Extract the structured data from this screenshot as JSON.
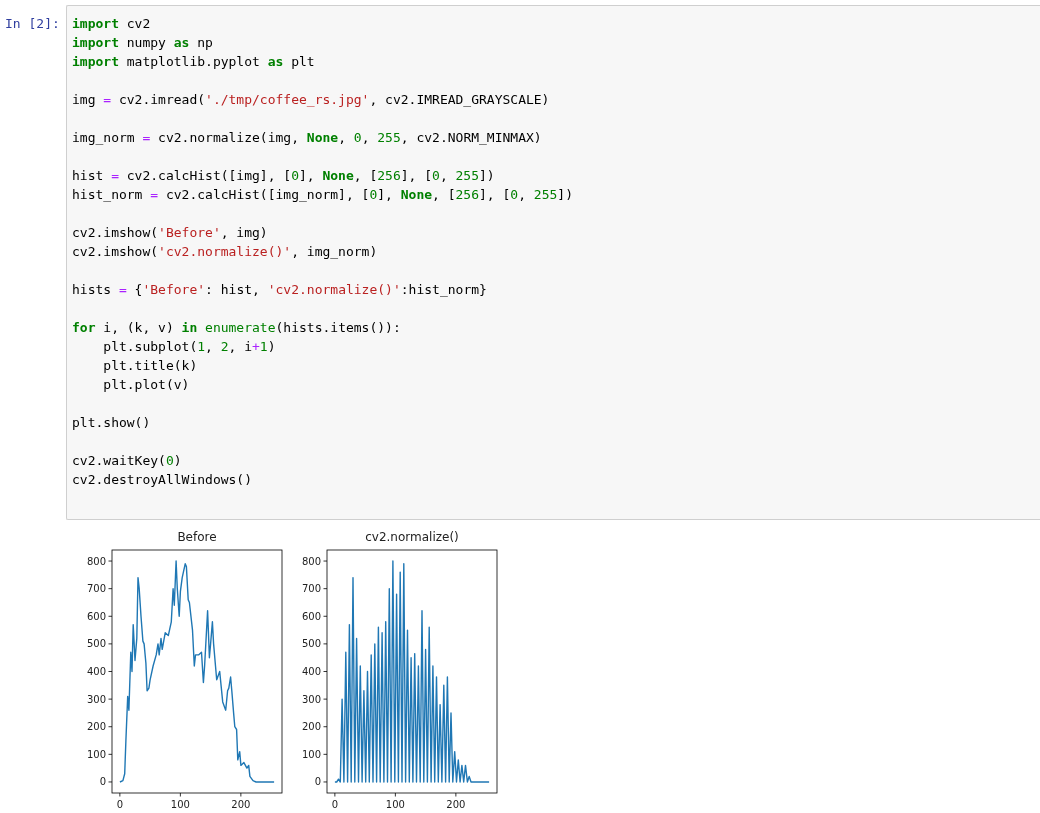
{
  "cell": {
    "prompt": "In [2]:",
    "blocks": [
      [
        [
          {
            "t": "import",
            "kind": "keyword"
          },
          {
            "t": " cv2",
            "kind": "plain"
          }
        ],
        [
          {
            "t": "import",
            "kind": "keyword"
          },
          {
            "t": " numpy ",
            "kind": "plain"
          },
          {
            "t": "as",
            "kind": "keyword"
          },
          {
            "t": " np",
            "kind": "plain"
          }
        ],
        [
          {
            "t": "import",
            "kind": "keyword"
          },
          {
            "t": " matplotlib.pyplot ",
            "kind": "plain"
          },
          {
            "t": "as",
            "kind": "keyword"
          },
          {
            "t": " plt",
            "kind": "plain"
          }
        ]
      ],
      [
        [
          {
            "t": "img ",
            "kind": "plain"
          },
          {
            "t": "=",
            "kind": "operator"
          },
          {
            "t": " cv2.imread(",
            "kind": "plain"
          },
          {
            "t": "'./tmp/coffee_rs.jpg'",
            "kind": "string"
          },
          {
            "t": ", cv2.IMREAD_GRAYSCALE)",
            "kind": "plain"
          }
        ]
      ],
      [
        [
          {
            "t": "img_norm ",
            "kind": "plain"
          },
          {
            "t": "=",
            "kind": "operator"
          },
          {
            "t": " cv2.normalize(img, ",
            "kind": "plain"
          },
          {
            "t": "None",
            "kind": "keyword"
          },
          {
            "t": ", ",
            "kind": "plain"
          },
          {
            "t": "0",
            "kind": "number"
          },
          {
            "t": ", ",
            "kind": "plain"
          },
          {
            "t": "255",
            "kind": "number"
          },
          {
            "t": ", cv2.NORM_MINMAX)",
            "kind": "plain"
          }
        ]
      ],
      [
        [
          {
            "t": "hist ",
            "kind": "plain"
          },
          {
            "t": "=",
            "kind": "operator"
          },
          {
            "t": " cv2.calcHist([img], [",
            "kind": "plain"
          },
          {
            "t": "0",
            "kind": "number"
          },
          {
            "t": "], ",
            "kind": "plain"
          },
          {
            "t": "None",
            "kind": "keyword"
          },
          {
            "t": ", [",
            "kind": "plain"
          },
          {
            "t": "256",
            "kind": "number"
          },
          {
            "t": "], [",
            "kind": "plain"
          },
          {
            "t": "0",
            "kind": "number"
          },
          {
            "t": ", ",
            "kind": "plain"
          },
          {
            "t": "255",
            "kind": "number"
          },
          {
            "t": "])",
            "kind": "plain"
          }
        ],
        [
          {
            "t": "hist_norm ",
            "kind": "plain"
          },
          {
            "t": "=",
            "kind": "operator"
          },
          {
            "t": " cv2.calcHist([img_norm], [",
            "kind": "plain"
          },
          {
            "t": "0",
            "kind": "number"
          },
          {
            "t": "], ",
            "kind": "plain"
          },
          {
            "t": "None",
            "kind": "keyword"
          },
          {
            "t": ", [",
            "kind": "plain"
          },
          {
            "t": "256",
            "kind": "number"
          },
          {
            "t": "], [",
            "kind": "plain"
          },
          {
            "t": "0",
            "kind": "number"
          },
          {
            "t": ", ",
            "kind": "plain"
          },
          {
            "t": "255",
            "kind": "number"
          },
          {
            "t": "])",
            "kind": "plain"
          }
        ]
      ],
      [
        [
          {
            "t": "cv2.imshow(",
            "kind": "plain"
          },
          {
            "t": "'Before'",
            "kind": "string"
          },
          {
            "t": ", img)",
            "kind": "plain"
          }
        ],
        [
          {
            "t": "cv2.imshow(",
            "kind": "plain"
          },
          {
            "t": "'cv2.normalize()'",
            "kind": "string"
          },
          {
            "t": ", img_norm)",
            "kind": "plain"
          }
        ]
      ],
      [
        [
          {
            "t": "hists ",
            "kind": "plain"
          },
          {
            "t": "=",
            "kind": "operator"
          },
          {
            "t": " {",
            "kind": "plain"
          },
          {
            "t": "'Before'",
            "kind": "string"
          },
          {
            "t": ": hist, ",
            "kind": "plain"
          },
          {
            "t": "'cv2.normalize()'",
            "kind": "string"
          },
          {
            "t": ":hist_norm}",
            "kind": "plain"
          }
        ]
      ],
      [
        [
          {
            "t": "for",
            "kind": "keyword"
          },
          {
            "t": " i, (k, v) ",
            "kind": "plain"
          },
          {
            "t": "in",
            "kind": "keyword"
          },
          {
            "t": " enumerate",
            "kind": "builtin"
          },
          {
            "t": "(hists.items()):",
            "kind": "plain"
          }
        ],
        [
          {
            "t": "    plt.subplot(",
            "kind": "plain"
          },
          {
            "t": "1",
            "kind": "number"
          },
          {
            "t": ", ",
            "kind": "plain"
          },
          {
            "t": "2",
            "kind": "number"
          },
          {
            "t": ", i",
            "kind": "plain"
          },
          {
            "t": "+",
            "kind": "operator"
          },
          {
            "t": "1",
            "kind": "number"
          },
          {
            "t": ")",
            "kind": "plain"
          }
        ],
        [
          {
            "t": "    plt.title(k)",
            "kind": "plain"
          }
        ],
        [
          {
            "t": "    plt.plot(v)",
            "kind": "plain"
          }
        ]
      ],
      [
        [
          {
            "t": "plt.show()",
            "kind": "plain"
          }
        ]
      ],
      [
        [
          {
            "t": "cv2.waitKey(",
            "kind": "plain"
          },
          {
            "t": "0",
            "kind": "number"
          },
          {
            "t": ")",
            "kind": "plain"
          }
        ],
        [
          {
            "t": "cv2.destroyAllWindows()",
            "kind": "plain"
          }
        ]
      ]
    ]
  },
  "output": {
    "charts": [
      {
        "chart_data": {
          "type": "line",
          "title": "Before",
          "xlim": [
            -13,
            268
          ],
          "ylim": [
            -40,
            840
          ],
          "xticks": [
            0,
            100,
            200
          ],
          "yticks": [
            0,
            100,
            200,
            300,
            400,
            500,
            600,
            700,
            800
          ],
          "series": [
            {
              "color": "#1f77b4",
              "x": [
                0,
                5,
                8,
                10,
                13,
                15,
                18,
                20,
                22,
                25,
                28,
                30,
                32,
                35,
                38,
                40,
                43,
                45,
                48,
                50,
                55,
                60,
                63,
                65,
                68,
                70,
                75,
                80,
                85,
                88,
                90,
                93,
                95,
                98,
                100,
                103,
                105,
                108,
                110,
                113,
                115,
                120,
                123,
                125,
                130,
                135,
                138,
                140,
                145,
                148,
                150,
                153,
                155,
                158,
                160,
                165,
                170,
                175,
                178,
                180,
                183,
                185,
                188,
                190,
                193,
                195,
                198,
                200,
                205,
                210,
                213,
                215,
                220,
                225,
                255
              ],
              "values": [
                0,
                5,
                30,
                150,
                310,
                260,
                470,
                400,
                570,
                440,
                520,
                740,
                700,
                600,
                510,
                500,
                430,
                330,
                340,
                370,
                420,
                460,
                500,
                460,
                520,
                480,
                540,
                530,
                580,
                700,
                640,
                800,
                700,
                600,
                690,
                740,
                760,
                790,
                780,
                660,
                650,
                550,
                420,
                460,
                460,
                470,
                360,
                420,
                620,
                450,
                500,
                580,
                500,
                420,
                370,
                400,
                290,
                260,
                330,
                340,
                380,
                330,
                250,
                200,
                190,
                80,
                110,
                60,
                70,
                50,
                60,
                20,
                5,
                0,
                0
              ]
            }
          ]
        }
      },
      {
        "chart_data": {
          "type": "line",
          "title": "cv2.normalize()",
          "xlim": [
            -13,
            268
          ],
          "ylim": [
            -40,
            840
          ],
          "xticks": [
            0,
            100,
            200
          ],
          "yticks": [
            0,
            100,
            200,
            300,
            400,
            500,
            600,
            700,
            800
          ],
          "series": [
            {
              "color": "#1f77b4",
              "x": [
                0,
                3,
                6,
                9,
                12,
                15,
                18,
                21,
                24,
                27,
                30,
                33,
                36,
                39,
                42,
                45,
                48,
                51,
                54,
                57,
                60,
                63,
                66,
                69,
                72,
                75,
                78,
                81,
                84,
                87,
                90,
                93,
                96,
                99,
                102,
                105,
                108,
                111,
                114,
                117,
                120,
                123,
                126,
                129,
                132,
                135,
                138,
                141,
                144,
                147,
                150,
                153,
                156,
                159,
                162,
                165,
                168,
                171,
                174,
                177,
                180,
                183,
                186,
                189,
                192,
                195,
                198,
                201,
                204,
                207,
                210,
                213,
                216,
                219,
                222,
                225,
                255
              ],
              "values": [
                0,
                0,
                10,
                0,
                300,
                0,
                470,
                0,
                570,
                0,
                740,
                0,
                520,
                0,
                420,
                0,
                330,
                0,
                400,
                0,
                460,
                0,
                500,
                0,
                560,
                0,
                540,
                0,
                580,
                0,
                700,
                0,
                800,
                0,
                680,
                0,
                760,
                0,
                790,
                0,
                550,
                0,
                450,
                0,
                465,
                0,
                420,
                0,
                620,
                0,
                480,
                0,
                560,
                0,
                420,
                0,
                380,
                0,
                280,
                0,
                350,
                0,
                380,
                0,
                250,
                0,
                110,
                0,
                80,
                0,
                60,
                0,
                60,
                0,
                20,
                0,
                0
              ]
            }
          ]
        }
      }
    ]
  }
}
